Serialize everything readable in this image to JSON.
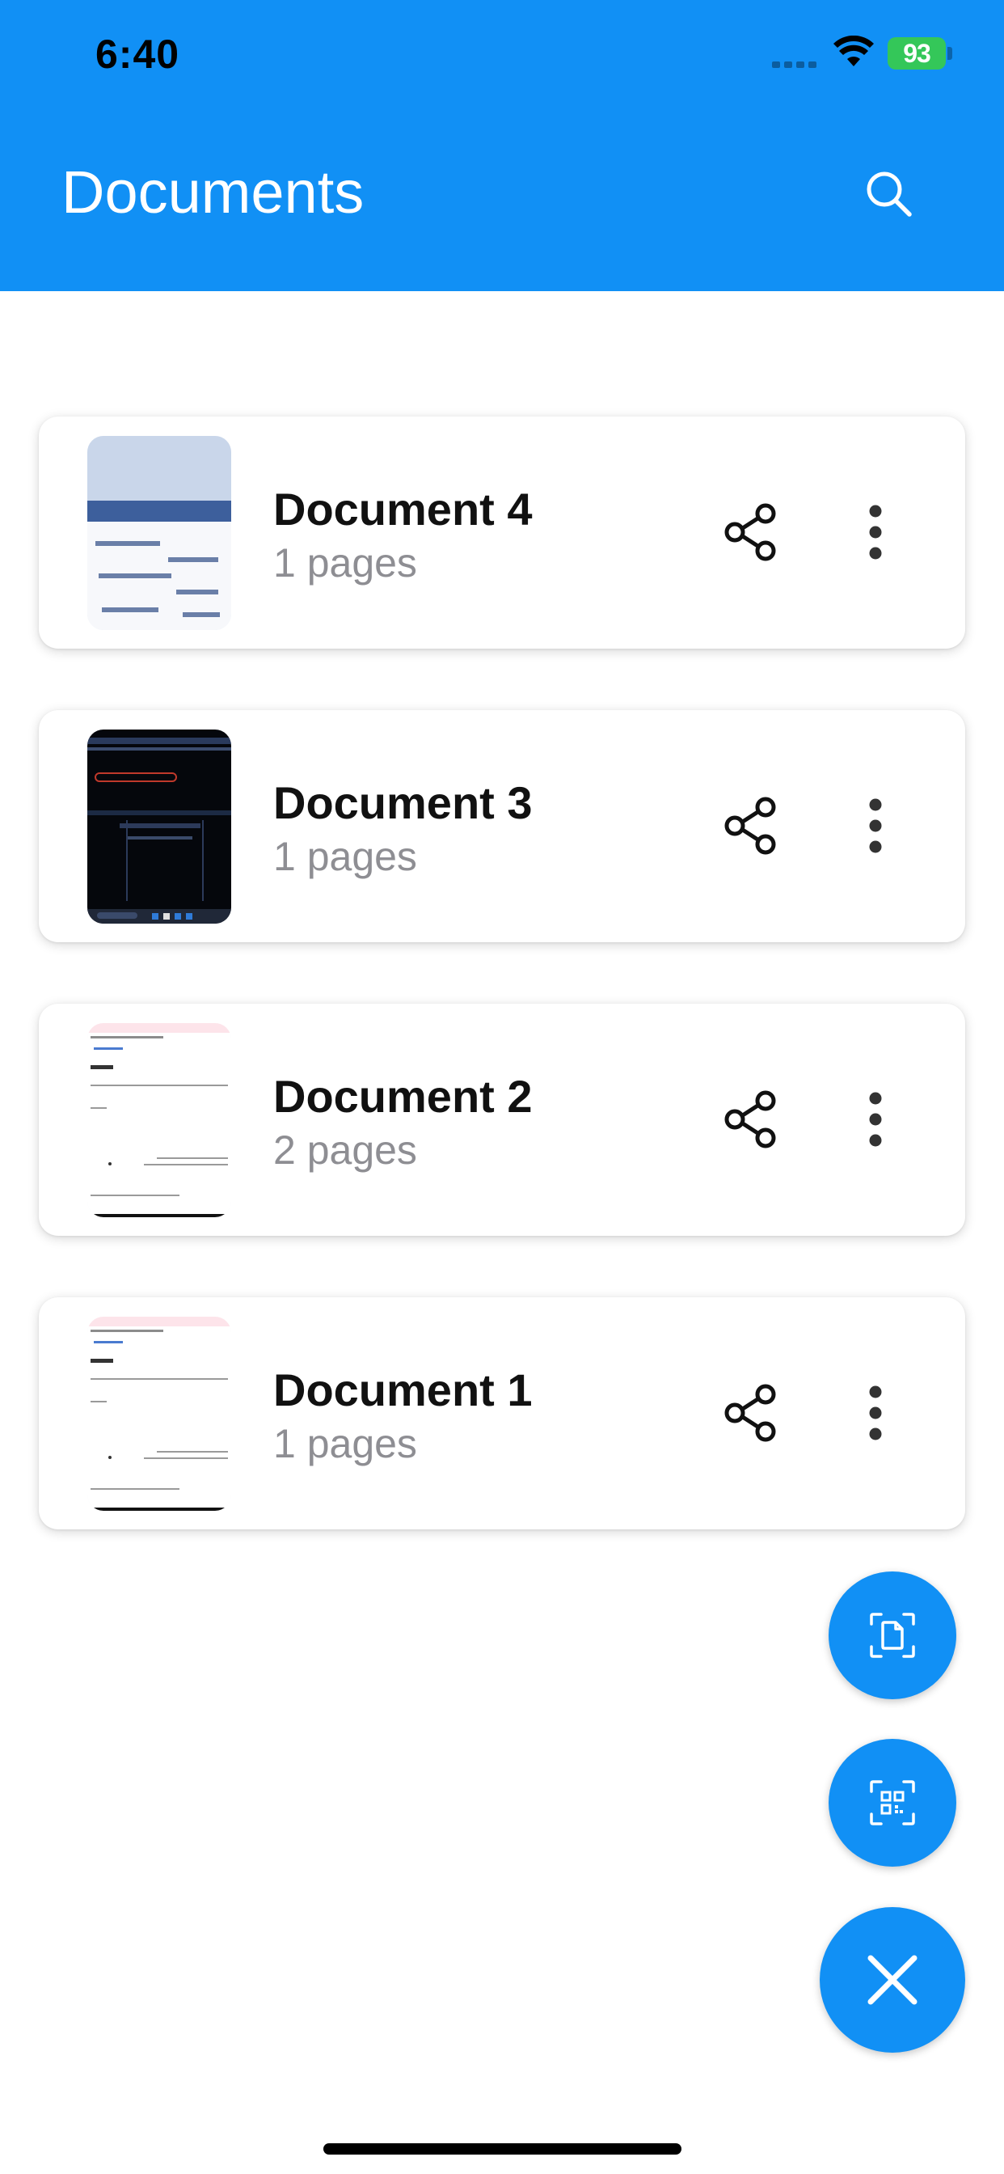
{
  "status_bar": {
    "time": "6:40",
    "battery": "93"
  },
  "header": {
    "title": "Documents",
    "search_icon": "search-icon"
  },
  "colors": {
    "primary": "#1190f5",
    "battery": "#34c759",
    "subtitle": "#8e8e93"
  },
  "documents": [
    {
      "name": "Document 4",
      "pages": "1 pages",
      "thumbnail": "photo-card-thumbnail"
    },
    {
      "name": "Document 3",
      "pages": "1 pages",
      "thumbnail": "dark-screen-thumbnail"
    },
    {
      "name": "Document 2",
      "pages": "2 pages",
      "thumbnail": "light-page-thumbnail"
    },
    {
      "name": "Document 1",
      "pages": "1 pages",
      "thumbnail": "light-page-thumbnail"
    }
  ],
  "fabs": {
    "scan_document_icon": "document-scan-icon",
    "scan_qr_icon": "qr-scan-icon",
    "close_icon": "close-icon"
  }
}
